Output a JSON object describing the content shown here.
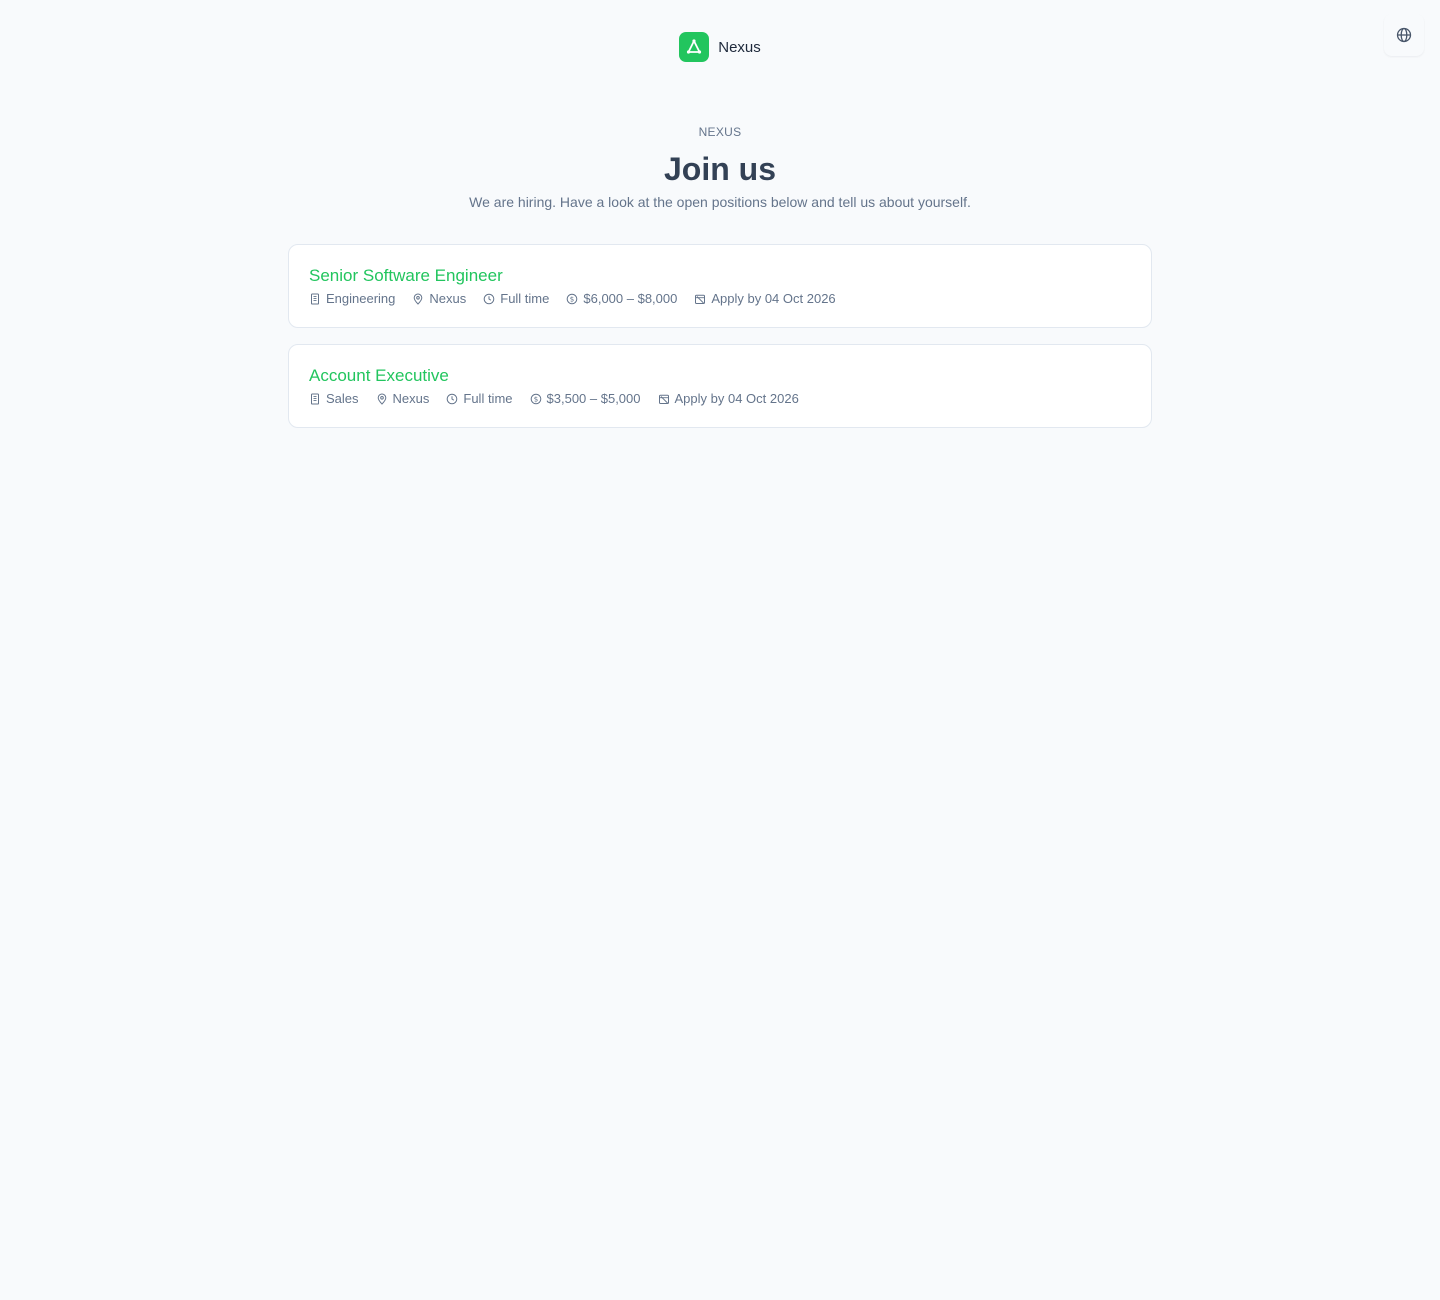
{
  "header": {
    "brand_name": "Nexus",
    "brand_color": "#22c55e",
    "logo_icon": "triangle-nodes-icon",
    "language_icon": "globe-icon"
  },
  "hero": {
    "eyebrow": "NEXUS",
    "title": "Join us",
    "subtitle": "We are hiring. Have a look at the open positions below and tell us about yourself."
  },
  "jobs": [
    {
      "title": "Senior Software Engineer",
      "department": "Engineering",
      "location": "Nexus",
      "employment_type": "Full time",
      "salary": "$6,000 – $8,000",
      "deadline": "Apply by 04 Oct 2026"
    },
    {
      "title": "Account Executive",
      "department": "Sales",
      "location": "Nexus",
      "employment_type": "Full time",
      "salary": "$3,500 – $5,000",
      "deadline": "Apply by 04 Oct 2026"
    }
  ],
  "colors": {
    "accent": "#22c55e",
    "background": "#f8fafc",
    "text_primary": "#334155",
    "text_muted": "#64748b",
    "card_border": "#e2e8f0"
  }
}
